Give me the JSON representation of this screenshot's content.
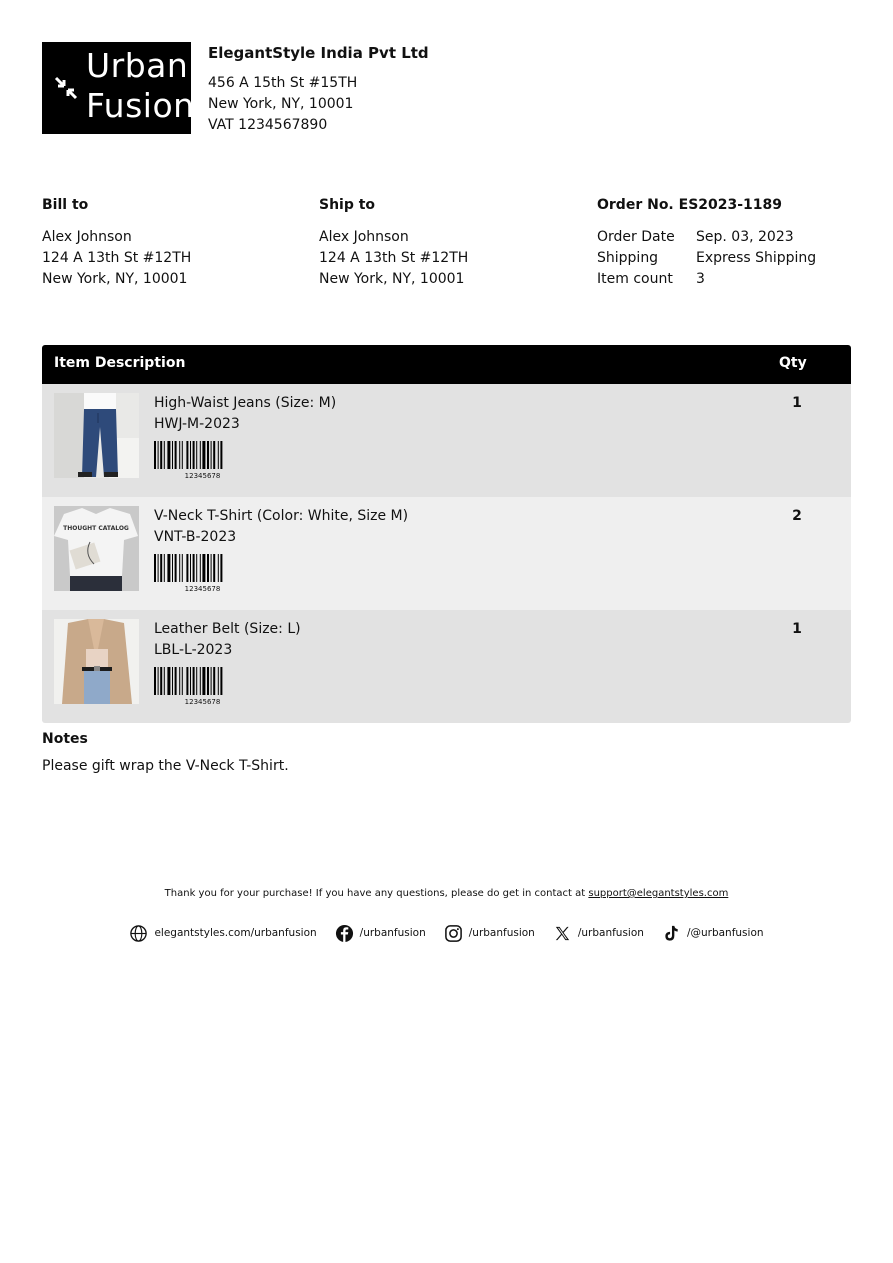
{
  "logo": {
    "line1": "Urban",
    "line2": "Fusion"
  },
  "company": {
    "name": "ElegantStyle India Pvt Ltd",
    "address1": "456 A 15th St #15TH",
    "address2": "New York, NY, 10001",
    "vat": "VAT 1234567890"
  },
  "bill_to": {
    "heading": "Bill to",
    "name": "Alex Johnson",
    "address1": "124 A 13th St #12TH",
    "address2": "New York, NY, 10001"
  },
  "ship_to": {
    "heading": "Ship to",
    "name": "Alex Johnson",
    "address1": "124 A 13th St #12TH",
    "address2": "New York, NY, 10001"
  },
  "order": {
    "heading": "Order No. ES2023-1189",
    "date_label": "Order Date",
    "date": "Sep. 03, 2023",
    "shipping_label": "Shipping",
    "shipping": "Express Shipping",
    "count_label": "Item count",
    "count": "3"
  },
  "table": {
    "col_description": "Item Description",
    "col_qty": "Qty",
    "items": [
      {
        "name": "High-Waist Jeans (Size: M)",
        "sku": "HWJ-M-2023",
        "barcode": "12345678",
        "qty": "1"
      },
      {
        "name": "V-Neck T-Shirt (Color: White, Size M)",
        "sku": "VNT-B-2023",
        "barcode": "12345678",
        "qty": "2",
        "shirt_print": "THOUGHT CATALOG"
      },
      {
        "name": "Leather Belt (Size: L)",
        "sku": "LBL-L-2023",
        "barcode": "12345678",
        "qty": "1"
      }
    ]
  },
  "notes": {
    "heading": "Notes",
    "text": "Please gift wrap the V-Neck T-Shirt."
  },
  "footer": {
    "thanks": "Thank you for your purchase! If you have any questions, please do get in contact at",
    "email": "support@elegantstyles.com",
    "website": "elegantstyles.com/urbanfusion",
    "facebook": "/urbanfusion",
    "instagram": "/urbanfusion",
    "x": "/urbanfusion",
    "tiktok": "/@urbanfusion"
  }
}
